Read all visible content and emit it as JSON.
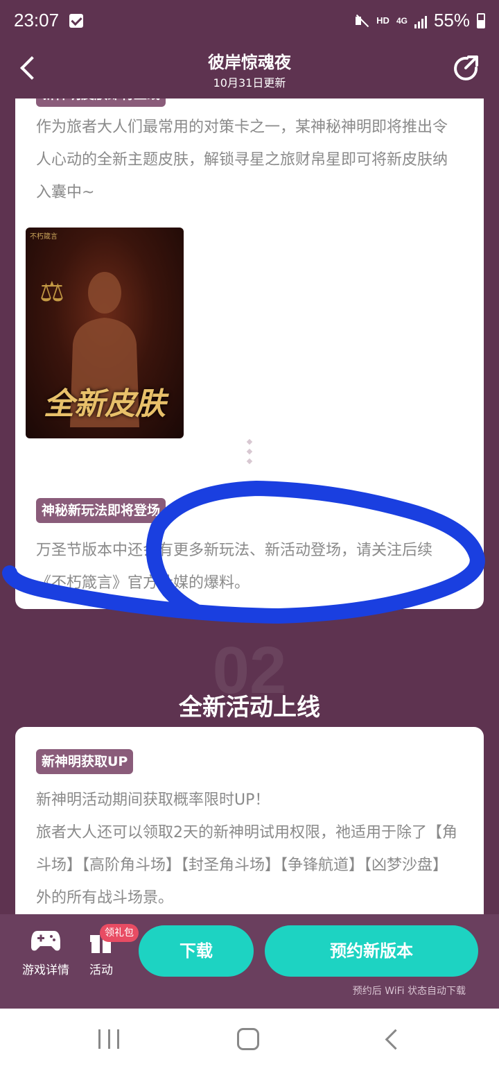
{
  "status_bar": {
    "time": "23:07",
    "network_hd": "HD",
    "network_4g": "4G",
    "battery": "55%"
  },
  "header": {
    "title": "彼岸惊魂夜",
    "subtitle": "10月31日更新"
  },
  "section_1": {
    "tag_skin": "新神明皮肤即将上线",
    "skin_paragraph": "作为旅者大人们最常用的对策卡之一，某神秘神明即将推出令人心动的全新主题皮肤，解锁寻星之旅财帛星即可将新皮肤纳入囊中~",
    "image_logo": "不朽箴言",
    "image_text": "全新皮肤",
    "tag_gameplay": "神秘新玩法即将登场",
    "gameplay_paragraph": "万圣节版本中还会有更多新玩法、新活动登场，请关注后续《不朽箴言》官方社媒的爆料。"
  },
  "section_2": {
    "number": "02",
    "title": "全新活动上线",
    "tag_up": "新神明获取UP",
    "paragraph": "新神明活动期间获取概率限时UP！\n旅者大人还可以领取2天的新神明试用权限，祂适用于除了【角斗场】【高阶角斗场】【封圣角斗场】【争锋航道】【凶梦沙盘】外的所有战斗场景。"
  },
  "bottom_bar": {
    "game_details": "游戏详情",
    "activity": "活动",
    "gift_badge": "领礼包",
    "download": "下载",
    "reserve": "预约新版本",
    "note": "预约后 WiFi 状态自动下载"
  },
  "colors": {
    "background": "#5e3350",
    "accent": "#1dd3c2",
    "tag": "#8a5c7a",
    "badge": "#e84c63",
    "scribble": "#1a3fe0"
  }
}
